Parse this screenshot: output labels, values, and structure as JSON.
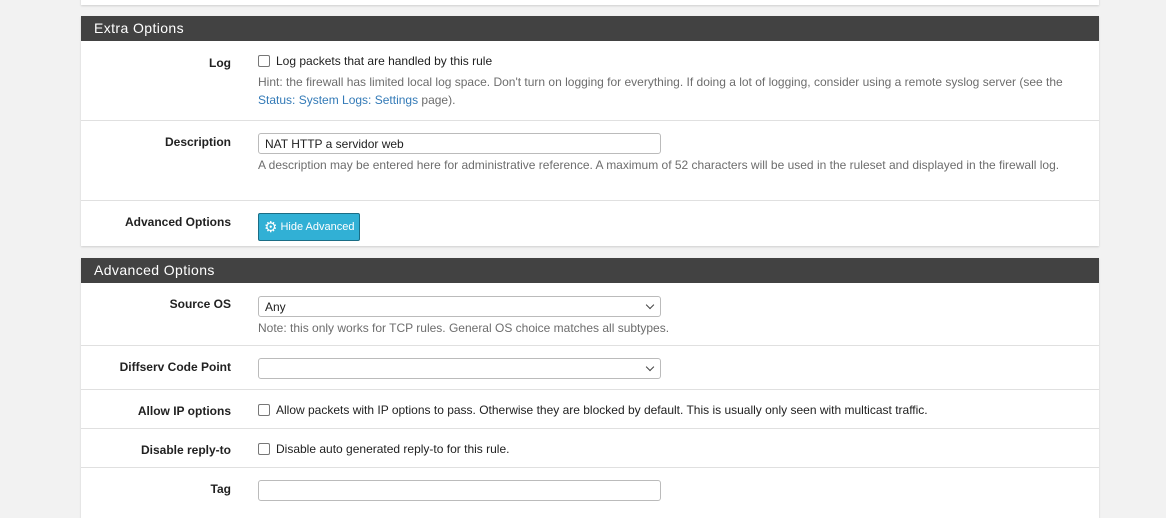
{
  "extra": {
    "title": "Extra Options",
    "log": {
      "label": "Log",
      "checkbox": "Log packets that are handled by this rule",
      "hint_pre": "Hint: the firewall has limited local log space. Don't turn on logging for everything. If doing a lot of logging, consider using a remote syslog server (see the ",
      "hint_link": "Status: System Logs: Settings",
      "hint_post": " page)."
    },
    "description": {
      "label": "Description",
      "value": "NAT HTTP a servidor web",
      "hint": "A description may be entered here for administrative reference. A maximum of 52 characters will be used in the ruleset and displayed in the firewall log."
    },
    "advanced": {
      "label": "Advanced Options",
      "button": "Hide Advanced"
    }
  },
  "advanced": {
    "title": "Advanced Options",
    "source_os": {
      "label": "Source OS",
      "value": "Any",
      "hint": "Note: this only works for TCP rules. General OS choice matches all subtypes."
    },
    "diffserv": {
      "label": "Diffserv Code Point",
      "value": ""
    },
    "allow_ip": {
      "label": "Allow IP options",
      "checkbox": "Allow packets with IP options to pass. Otherwise they are blocked by default. This is usually only seen with multicast traffic."
    },
    "reply_to": {
      "label": "Disable reply-to",
      "checkbox": "Disable auto generated reply-to for this rule."
    },
    "tag": {
      "label": "Tag",
      "value": ""
    }
  }
}
